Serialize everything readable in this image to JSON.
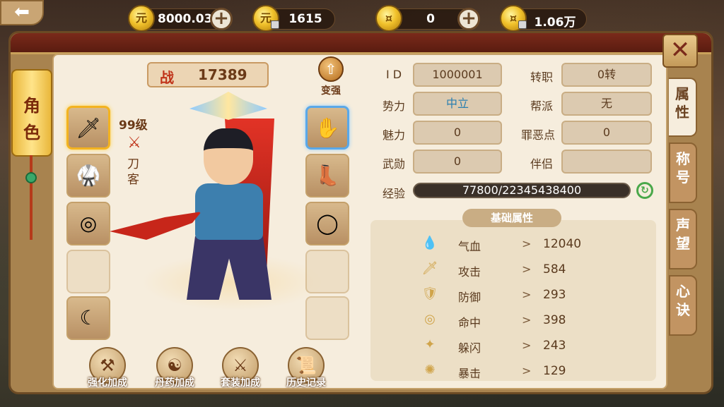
{
  "currencies": [
    {
      "icon": "gold-ingot-icon",
      "value": "8000.03",
      "has_plus": true,
      "locked": false
    },
    {
      "icon": "bound-gold-ingot-icon",
      "value": "1615",
      "has_plus": false,
      "locked": true
    },
    {
      "icon": "coin-icon",
      "value": "0",
      "has_plus": true,
      "locked": false
    },
    {
      "icon": "bound-coin-icon",
      "value": "1.06万",
      "has_plus": false,
      "locked": true
    }
  ],
  "left_scroll_tab": {
    "char1": "角",
    "char2": "色"
  },
  "side_tabs": [
    {
      "label": "属性",
      "active": true
    },
    {
      "label": "称号",
      "active": false
    },
    {
      "label": "声望",
      "active": false
    },
    {
      "label": "心诀",
      "active": false
    }
  ],
  "close_symbol": "✕",
  "power": {
    "label": "战",
    "value": "17389"
  },
  "strengthen_label": "变强",
  "character": {
    "level": "99级",
    "class_name": "刀客"
  },
  "left_slots": [
    {
      "name": "weapon-slot",
      "icon": "🗡",
      "state": "selected"
    },
    {
      "name": "armor-slot",
      "icon": "🥋",
      "state": "filled"
    },
    {
      "name": "bracelet-slot",
      "icon": "◎",
      "state": "filled"
    },
    {
      "name": "empty-slot",
      "icon": "",
      "state": "empty"
    },
    {
      "name": "pendant-slot",
      "icon": "☾",
      "state": "filled"
    }
  ],
  "right_slots": [
    {
      "name": "gloves-slot",
      "icon": "✋",
      "state": "selected"
    },
    {
      "name": "boots-slot",
      "icon": "👢",
      "state": "filled"
    },
    {
      "name": "ring-slot",
      "icon": "◯",
      "state": "filled"
    },
    {
      "name": "empty-slot",
      "icon": "",
      "state": "empty"
    },
    {
      "name": "empty-slot",
      "icon": "",
      "state": "empty"
    }
  ],
  "bottom_buttons": [
    {
      "label": "强化加成",
      "icon": "⚒"
    },
    {
      "label": "丹药加成",
      "icon": "☯"
    },
    {
      "label": "套装加成",
      "icon": "⚔"
    },
    {
      "label": "历史记录",
      "icon": "📜"
    }
  ],
  "info": {
    "id_label": "I D",
    "id_value": "1000001",
    "rebirth_label": "转职",
    "rebirth_value": "0转",
    "faction_label": "势力",
    "faction_value": "中立",
    "guild_label": "帮派",
    "guild_value": "无",
    "charm_label": "魅力",
    "charm_value": "0",
    "evil_label": "罪恶点",
    "evil_value": "0",
    "merit_label": "武勋",
    "merit_value": "0",
    "partner_label": "伴侣",
    "partner_value": "",
    "exp_label": "经验",
    "exp_value": "77800/22345438400"
  },
  "base_attr_title": "基础属性",
  "stats": [
    {
      "icon": "drop-icon",
      "glyph": "💧",
      "name": "气血",
      "value": "12040"
    },
    {
      "icon": "sword-icon",
      "glyph": "🗡",
      "name": "攻击",
      "value": "584"
    },
    {
      "icon": "shield-icon",
      "glyph": "🛡",
      "name": "防御",
      "value": "293"
    },
    {
      "icon": "target-icon",
      "glyph": "◎",
      "name": "命中",
      "value": "398"
    },
    {
      "icon": "dodge-icon",
      "glyph": "✦",
      "name": "躲闪",
      "value": "243"
    },
    {
      "icon": "crit-icon",
      "glyph": "✺",
      "name": "暴击",
      "value": "129"
    }
  ],
  "arrow": ">"
}
